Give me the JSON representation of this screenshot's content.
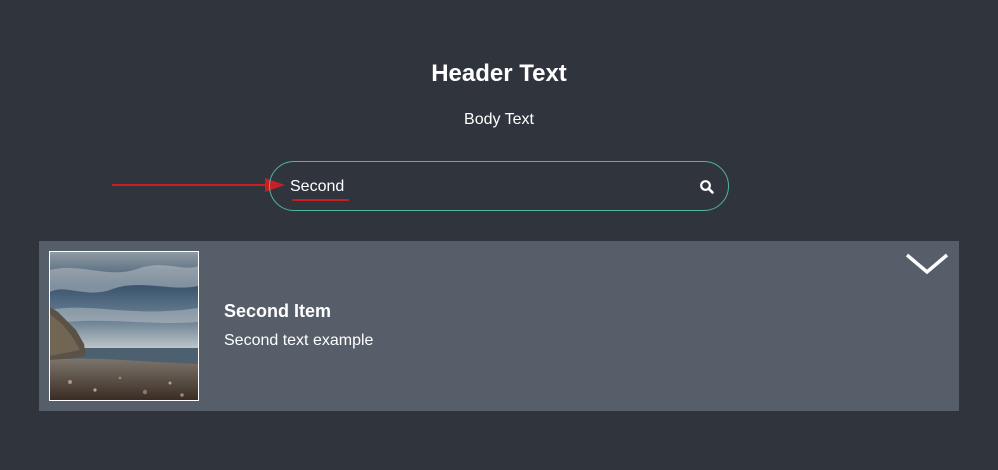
{
  "header": {
    "title": "Header Text",
    "body": "Body Text"
  },
  "search": {
    "value": "Second",
    "placeholder": "",
    "icon": "search-icon",
    "border_color": "#4fb59c"
  },
  "annotation": {
    "color": "#c61f24"
  },
  "results": [
    {
      "title": "Second Item",
      "text": "Second text example",
      "image": "rocky-beach-under-cloudy-sky"
    }
  ],
  "colors": {
    "background": "#30343d",
    "card": "#555e69",
    "text": "#ffffff"
  }
}
